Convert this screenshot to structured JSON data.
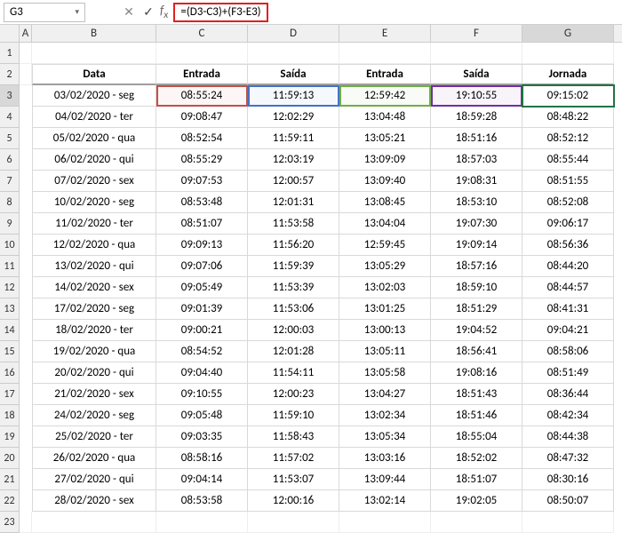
{
  "nameBox": "G3",
  "formula": "=(D3-C3)+(F3-E3)",
  "columns": [
    "A",
    "B",
    "C",
    "D",
    "E",
    "F",
    "G"
  ],
  "headers": {
    "B": "Data",
    "C": "Entrada",
    "D": "Saída",
    "E": "Entrada",
    "F": "Saída",
    "G": "Jornada"
  },
  "selectedCol": "G",
  "selectedRow": 3,
  "rows": [
    {
      "n": 3,
      "B": "03/02/2020 - seg",
      "C": "08:55:24",
      "D": "11:59:13",
      "E": "12:59:42",
      "F": "19:10:55",
      "G": "09:15:02"
    },
    {
      "n": 4,
      "B": "04/02/2020 - ter",
      "C": "09:08:47",
      "D": "12:02:29",
      "E": "13:04:48",
      "F": "18:59:28",
      "G": "08:48:22"
    },
    {
      "n": 5,
      "B": "05/02/2020 - qua",
      "C": "08:52:54",
      "D": "11:59:11",
      "E": "13:05:21",
      "F": "18:51:16",
      "G": "08:52:12"
    },
    {
      "n": 6,
      "B": "06/02/2020 - qui",
      "C": "08:55:29",
      "D": "12:03:19",
      "E": "13:09:09",
      "F": "18:57:03",
      "G": "08:55:44"
    },
    {
      "n": 7,
      "B": "07/02/2020 - sex",
      "C": "09:07:53",
      "D": "12:00:57",
      "E": "13:09:40",
      "F": "19:08:31",
      "G": "08:51:55"
    },
    {
      "n": 8,
      "B": "10/02/2020 - seg",
      "C": "08:53:48",
      "D": "12:01:31",
      "E": "13:08:45",
      "F": "18:53:10",
      "G": "08:52:08"
    },
    {
      "n": 9,
      "B": "11/02/2020 - ter",
      "C": "08:51:07",
      "D": "11:53:58",
      "E": "13:04:04",
      "F": "19:07:30",
      "G": "09:06:17"
    },
    {
      "n": 10,
      "B": "12/02/2020 - qua",
      "C": "09:09:13",
      "D": "11:56:20",
      "E": "12:59:45",
      "F": "19:09:14",
      "G": "08:56:36"
    },
    {
      "n": 11,
      "B": "13/02/2020 - qui",
      "C": "09:07:06",
      "D": "11:59:39",
      "E": "13:05:29",
      "F": "18:57:16",
      "G": "08:44:20"
    },
    {
      "n": 12,
      "B": "14/02/2020 - sex",
      "C": "09:05:49",
      "D": "11:53:39",
      "E": "13:02:03",
      "F": "18:59:10",
      "G": "08:44:57"
    },
    {
      "n": 13,
      "B": "17/02/2020 - seg",
      "C": "09:01:39",
      "D": "11:53:06",
      "E": "13:01:25",
      "F": "18:51:29",
      "G": "08:41:31"
    },
    {
      "n": 14,
      "B": "18/02/2020 - ter",
      "C": "09:00:21",
      "D": "12:00:03",
      "E": "13:00:13",
      "F": "19:04:52",
      "G": "09:04:21"
    },
    {
      "n": 15,
      "B": "19/02/2020 - qua",
      "C": "08:54:52",
      "D": "12:01:28",
      "E": "13:05:11",
      "F": "18:56:41",
      "G": "08:58:06"
    },
    {
      "n": 16,
      "B": "20/02/2020 - qui",
      "C": "09:04:40",
      "D": "11:54:11",
      "E": "13:05:58",
      "F": "19:08:16",
      "G": "08:51:49"
    },
    {
      "n": 17,
      "B": "21/02/2020 - sex",
      "C": "09:10:55",
      "D": "12:00:23",
      "E": "13:04:27",
      "F": "18:51:43",
      "G": "08:36:44"
    },
    {
      "n": 18,
      "B": "24/02/2020 - seg",
      "C": "09:05:48",
      "D": "11:59:10",
      "E": "13:02:34",
      "F": "18:51:46",
      "G": "08:42:34"
    },
    {
      "n": 19,
      "B": "25/02/2020 - ter",
      "C": "09:03:35",
      "D": "11:58:43",
      "E": "13:05:34",
      "F": "18:55:04",
      "G": "08:44:38"
    },
    {
      "n": 20,
      "B": "26/02/2020 - qua",
      "C": "08:58:16",
      "D": "11:57:02",
      "E": "13:03:16",
      "F": "18:52:02",
      "G": "08:47:32"
    },
    {
      "n": 21,
      "B": "27/02/2020 - qui",
      "C": "09:04:14",
      "D": "11:53:07",
      "E": "13:09:44",
      "F": "18:51:07",
      "G": "08:30:16"
    },
    {
      "n": 22,
      "B": "28/02/2020 - sex",
      "C": "08:53:58",
      "D": "12:00:16",
      "E": "13:02:14",
      "F": "19:02:05",
      "G": "08:50:07"
    }
  ]
}
